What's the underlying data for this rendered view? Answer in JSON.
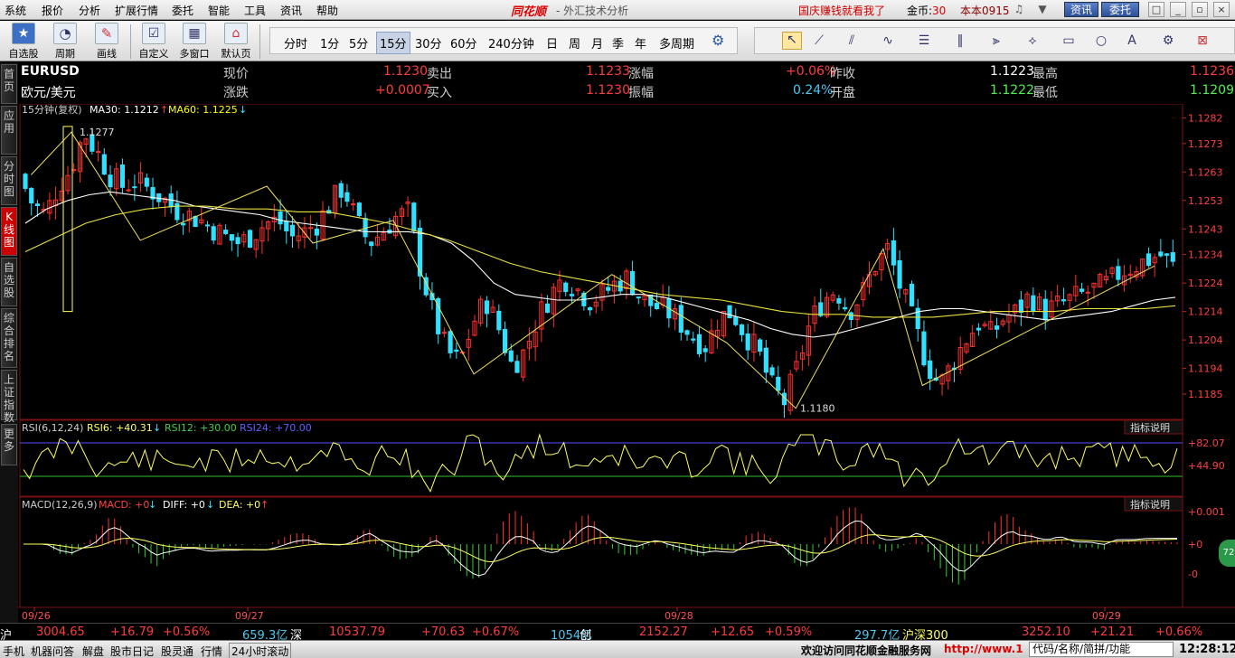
{
  "menu": [
    "系统",
    "报价",
    "分析",
    "扩展行情",
    "委托",
    "智能",
    "工具",
    "资讯",
    "帮助"
  ],
  "app": {
    "logo": "同花顺",
    "title": "- 外汇技术分析"
  },
  "promo": "国庆赚钱就看我了",
  "coins": {
    "label": "金币:",
    "value": "30"
  },
  "user": "本本0915",
  "topbuttons": {
    "news": "资讯",
    "trade": "委托"
  },
  "toolbar": [
    "自选股",
    "周期",
    "画线",
    "自定义",
    "多窗口",
    "默认页"
  ],
  "periods": [
    "分时",
    "1分",
    "5分",
    "15分",
    "30分",
    "60分",
    "240分钟",
    "日",
    "周",
    "月",
    "季",
    "年",
    "多周期"
  ],
  "selected_period": "15分",
  "lefttabs": [
    "首页",
    "应用",
    "分时图",
    "K线图",
    "自选股",
    "综合排名",
    "上证指数",
    "更多"
  ],
  "quote": {
    "symbol": "EURUSD",
    "name": "欧元/美元",
    "l_xj": "现价",
    "v_xj": "1.1230",
    "l_mc": "卖出",
    "v_mc": "1.1233",
    "l_zf": "涨幅",
    "v_zf": "+0.06%",
    "l_zs": "昨收",
    "v_zs": "1.1223",
    "l_zg": "最高",
    "v_zg": "1.1236",
    "l_zd": "涨跌",
    "v_zd": "+0.0007",
    "l_mr": "买入",
    "v_mr": "1.1230",
    "l_zfu": "振幅",
    "v_zfu": "0.24%",
    "l_kp": "开盘",
    "v_kp": "1.1222",
    "l_zd2": "最低",
    "v_zd2": "1.1209"
  },
  "chart_data": {
    "type": "candlestick",
    "period_label": "15分钟(复权)",
    "ma": [
      {
        "name": "MA30",
        "value": "1.1212",
        "dir": "↑",
        "color": "#ffffff"
      },
      {
        "name": "MA60",
        "value": "1.1225",
        "dir": "↓",
        "color": "#ffff00"
      }
    ],
    "ylim": [
      1.1178,
      1.1285
    ],
    "yticks": [
      "1.1282",
      "1.1273",
      "1.1263",
      "1.1253",
      "1.1243",
      "1.1234",
      "1.1224",
      "1.1214",
      "1.1204",
      "1.1194",
      "1.1185"
    ],
    "annot_high": "1.1277",
    "annot_low": "1.1180",
    "dates": [
      "09/26",
      "09/27",
      "09/28",
      "09/29"
    ],
    "close": [
      1.1262,
      1.1252,
      1.1248,
      1.1258,
      1.1264,
      1.1277,
      1.127,
      1.1262,
      1.1258,
      1.126,
      1.1257,
      1.1254,
      1.125,
      1.1248,
      1.1246,
      1.1243,
      1.124,
      1.1238,
      1.1241,
      1.1245,
      1.1246,
      1.124,
      1.1242,
      1.1245,
      1.1252,
      1.1258,
      1.1246,
      1.1238,
      1.1242,
      1.1247,
      1.1249,
      1.1228,
      1.1212,
      1.12,
      1.1196,
      1.121,
      1.1218,
      1.1208,
      1.1195,
      1.12,
      1.1212,
      1.122,
      1.1226,
      1.1222,
      1.1218,
      1.122,
      1.1224,
      1.1226,
      1.1218,
      1.1216,
      1.1214,
      1.121,
      1.1205,
      1.1202,
      1.1212,
      1.1214,
      1.1206,
      1.12,
      1.1188,
      1.1182,
      1.1194,
      1.121,
      1.1218,
      1.1222,
      1.1214,
      1.122,
      1.123,
      1.1236,
      1.1222,
      1.121,
      1.1196,
      1.1188,
      1.1196,
      1.1204,
      1.121,
      1.1206,
      1.1212,
      1.1214,
      1.122,
      1.1214,
      1.1216,
      1.1218,
      1.122,
      1.1222,
      1.1224,
      1.1228,
      1.123,
      1.1232,
      1.1234,
      1.123
    ],
    "ma30": [
      1.1245,
      1.125,
      1.1253,
      1.1255,
      1.1256,
      1.1255,
      1.1254,
      1.1253,
      1.1251,
      1.125,
      1.1249,
      1.1248,
      1.1246,
      1.1245,
      1.1244,
      1.1243,
      1.1242,
      1.1242,
      1.1242,
      1.1241,
      1.1238,
      1.1232,
      1.1224,
      1.122,
      1.1219,
      1.1218,
      1.1218,
      1.1219,
      1.122,
      1.122,
      1.1219,
      1.1217,
      1.1215,
      1.1213,
      1.1211,
      1.1208,
      1.1206,
      1.1205,
      1.1206,
      1.1208,
      1.121,
      1.1212,
      1.1214,
      1.1215,
      1.1215,
      1.1214,
      1.1213,
      1.1212,
      1.1211,
      1.1212,
      1.1213,
      1.1214,
      1.1216,
      1.1218,
      1.1219
    ],
    "ma60": [
      1.1235,
      1.124,
      1.1245,
      1.1248,
      1.125,
      1.1251,
      1.1251,
      1.125,
      1.125,
      1.1249,
      1.1249,
      1.1247,
      1.1245,
      1.1242,
      1.1239,
      1.1235,
      1.1231,
      1.1228,
      1.1226,
      1.1224,
      1.1222,
      1.122,
      1.1219,
      1.1218,
      1.1216,
      1.1214,
      1.1213,
      1.1213,
      1.1212,
      1.1212,
      1.1212,
      1.1213,
      1.1214,
      1.1214,
      1.1214,
      1.1215,
      1.1215,
      1.1215,
      1.1216
    ],
    "zigzag": [
      1.1262,
      1.1277,
      1.1239,
      1.1258,
      1.1238,
      1.1246,
      1.1192,
      1.1227,
      1.1203,
      1.118,
      1.1236,
      1.1188,
      1.123
    ],
    "rsi": {
      "label": "RSI(6,12,24)",
      "rsi6": "RSI6: +40.31",
      "rsi6_dir": "↓",
      "rsi12": "RSI12: +30.00",
      "rsi24": "RSI24: +70.00",
      "ticks": [
        "+82.07",
        "+44.90"
      ],
      "help": "指标说明"
    },
    "macd": {
      "label": "MACD(12,26,9)",
      "macd": "MACD: +0",
      "macd_dir": "↓",
      "diff": "DIFF: +0",
      "diff_dir": "↓",
      "dea": "DEA: +0",
      "dea_dir": "↑",
      "ticks": [
        "+0.001",
        "+0",
        "-0"
      ],
      "help": "指标说明"
    }
  },
  "indexbar": [
    {
      "t": "沪",
      "c": "#fff"
    },
    {
      "t": "3004.65",
      "c": "#ff3c3c"
    },
    {
      "t": "+16.79",
      "c": "#ff3c3c"
    },
    {
      "t": "+0.56%",
      "c": "#ff3c3c"
    },
    {
      "t": "659.3亿",
      "c": "#4cc8f0"
    },
    {
      "t": "深",
      "c": "#fff"
    },
    {
      "t": "10537.79",
      "c": "#ff3c3c"
    },
    {
      "t": "+70.63",
      "c": "#ff3c3c"
    },
    {
      "t": "+0.67%",
      "c": "#ff3c3c"
    },
    {
      "t": "1054亿",
      "c": "#4cc8f0"
    },
    {
      "t": "创",
      "c": "#fff"
    },
    {
      "t": "2152.27",
      "c": "#ff3c3c"
    },
    {
      "t": "+12.65",
      "c": "#ff3c3c"
    },
    {
      "t": "+0.59%",
      "c": "#ff3c3c"
    },
    {
      "t": "297.7亿",
      "c": "#4cc8f0"
    },
    {
      "t": "沪深300",
      "c": "#ffff66"
    },
    {
      "t": "3252.10",
      "c": "#ff3c3c"
    },
    {
      "t": "+21.21",
      "c": "#ff3c3c"
    },
    {
      "t": "+0.66%",
      "c": "#ff3c3c"
    }
  ],
  "status": {
    "items": [
      "手机",
      "机器问答",
      "解盘",
      "股市日记",
      "股灵通",
      "行情",
      "24小时滚动"
    ],
    "welcome": "欢迎访问同花顺金融服务网",
    "url": "http://www.1",
    "search": "代码/名称/简拼/功能",
    "clock": "12:28:12"
  },
  "badge": "72"
}
